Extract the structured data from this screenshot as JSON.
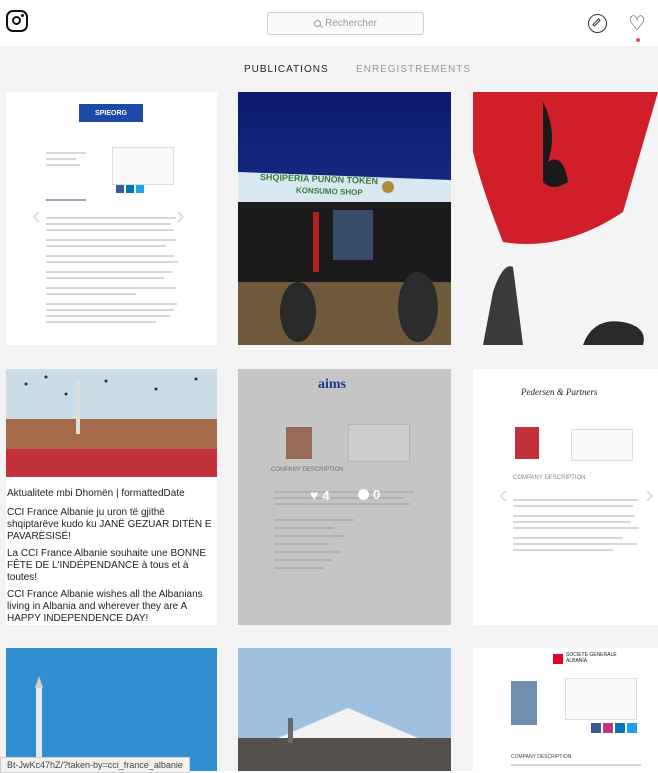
{
  "header": {
    "search_placeholder": "Rechercher"
  },
  "tabs": [
    {
      "label": "PUBLICATIONS",
      "active": true
    },
    {
      "label": "ENREGISTREMENTS",
      "active": false
    }
  ],
  "posts": {
    "p1": {
      "header_label": "SPIEORG"
    },
    "p2": {
      "banner_text_1": "SHQIPERIA PUNON TOKEN",
      "banner_text_2": "KONSUMO SHOP"
    },
    "p4": {
      "title": "Aktualitete mbi Dhomën | formattedDate",
      "para1": "CCI France Albanie ju uron të gjithë shqiptarëve kudo ku JANË GEZUAR DITËN E PAVARËSISË!",
      "para2": "La CCI France Albanie souhaite une BONNE FÊTE DE L'INDÉPENDANCE à tous et à toutes!",
      "para3": "CCI France Albanie wishes all the Albanians living in Albania and wherever they are A HAPPY INDEPENDENCE DAY!"
    },
    "p5": {
      "logo": "aims",
      "likes": "4",
      "comments": "0",
      "section": "COMPANY DESCRIPTION"
    },
    "p6": {
      "logo": "Pedersen & Partners",
      "section": "COMPANY DESCRIPTION"
    },
    "p9": {
      "logo_line1": "SOCIETE GENERALE",
      "logo_line2": "ALBANIA",
      "section": "COMPANY DESCRIPTION"
    }
  },
  "status_url": "Bt-JwKc47hZ/?taken-by=cci_france_albanie",
  "colors": {
    "accent_red": "#ed4956",
    "doc_blue": "#1c4aa6"
  }
}
